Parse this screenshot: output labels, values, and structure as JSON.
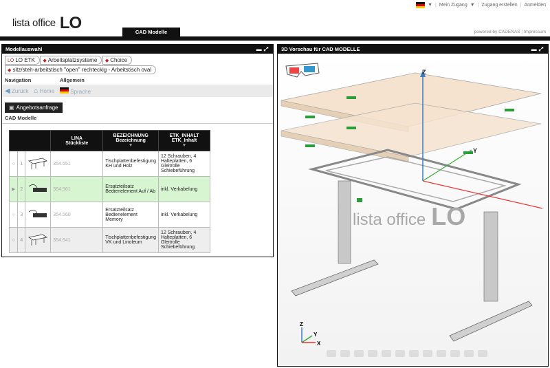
{
  "header": {
    "logo_text": "lista office",
    "logo_mark": "LO",
    "links": [
      "Mein Zugang",
      "Zugang erstellen",
      "Anmelden"
    ],
    "powered": "powered by CADENAS",
    "impressum": "Impressum"
  },
  "nav": {
    "active_tab": "CAD Modelle"
  },
  "left_panel": {
    "title": "Modellauswahl",
    "breadcrumbs": [
      "LO ETK",
      "Arbeitsplatzsysteme",
      "Choice"
    ],
    "breadcrumb_current": "sitz/steh-arbeitstisch \"open\" rechteckig - Arbeitstisch oval",
    "navigation_label": "Navigation",
    "allgemein_label": "Allgemein",
    "back_label": "Zurück",
    "home_label": "Home",
    "sprache_label": "Sprache",
    "angebot_label": "Angebotsanfrage",
    "cad_models_label": "CAD Modelle",
    "table": {
      "headers": [
        {
          "line1": "LINA",
          "line2": "Stückliste"
        },
        {
          "line1": "BEZEICHNUNG",
          "line2": "Bezeichnung"
        },
        {
          "line1": "ETK_INHALT",
          "line2": "ETK_Inhalt"
        }
      ],
      "rows": [
        {
          "num": "1",
          "nr": "354.551",
          "bez": "Tischplattenbefestigung KH und Holz",
          "etk": "12 Schrauben, 4 Halteplatten, 6 Gleitrolle Schiebeführung"
        },
        {
          "num": "2",
          "nr": "354.561",
          "bez": "Ersatzteilsatz Bedienelement Auf / Ab",
          "etk": "inkl. Verkabelung"
        },
        {
          "num": "3",
          "nr": "354.560",
          "bez": "Ersatzteilsatz Bedienelement Memory",
          "etk": "inkl. Verkabelung"
        },
        {
          "num": "4",
          "nr": "354.641",
          "bez": "Tischplattenbefestigung VK und Linoleum",
          "etk": "12 Schrauben, 4 Halteplatten, 6 Gleitrolle Schiebeführung"
        }
      ]
    }
  },
  "right_panel": {
    "title": "3D Vorschau für CAD MODELLE",
    "watermark": "lista office",
    "watermark_mark": "LO",
    "axes": {
      "z": "Z",
      "y": "Y",
      "x": "X"
    }
  }
}
